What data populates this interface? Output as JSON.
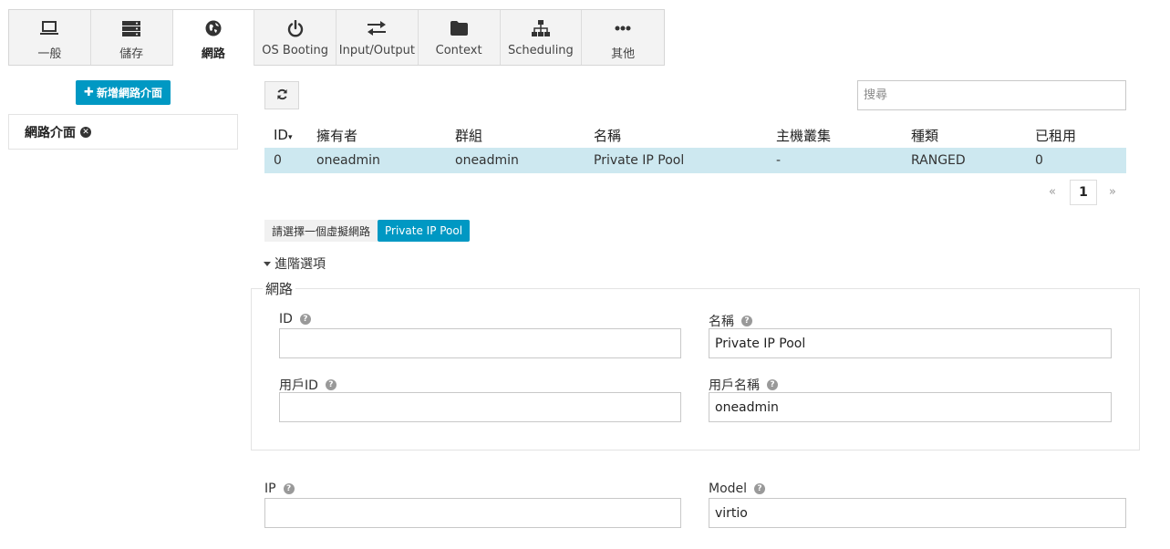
{
  "tabs": [
    {
      "label": "一般",
      "icon": "laptop-icon"
    },
    {
      "label": "儲存",
      "icon": "server-icon"
    },
    {
      "label": "網路",
      "icon": "globe-icon",
      "active": true
    },
    {
      "label": "OS Booting",
      "icon": "power-icon"
    },
    {
      "label": "Input/Output",
      "icon": "exchange-icon"
    },
    {
      "label": "Context",
      "icon": "folder-icon"
    },
    {
      "label": "Scheduling",
      "icon": "sitemap-icon"
    },
    {
      "label": "其他",
      "icon": "ellipsis-icon"
    }
  ],
  "left_panel": {
    "add_button": "新增網路介面",
    "nic_item": "網路介面"
  },
  "search": {
    "placeholder": "搜尋",
    "value": ""
  },
  "table": {
    "columns": [
      "ID",
      "擁有者",
      "群組",
      "名稱",
      "主機叢集",
      "種類",
      "已租用"
    ],
    "sort_indicator": "▾",
    "rows": [
      [
        "0",
        "oneadmin",
        "oneadmin",
        "Private IP Pool",
        "-",
        "RANGED",
        "0"
      ]
    ]
  },
  "pagination": {
    "prev": "«",
    "current": "1",
    "next": "»"
  },
  "selection": {
    "label": "請選擇一個虛擬網路",
    "selected": "Private IP Pool"
  },
  "advanced": {
    "label": "進階選項"
  },
  "network_fieldset": {
    "legend": "網路",
    "id_label": "ID",
    "id_value": "",
    "name_label": "名稱",
    "name_value": "Private IP Pool",
    "uid_label": "用戶ID",
    "uid_value": "",
    "uname_label": "用戶名稱",
    "uname_value": "oneadmin"
  },
  "ip_field": {
    "label": "IP",
    "value": ""
  },
  "model_field": {
    "label": "Model",
    "value": "virtio"
  },
  "colors": {
    "accent": "#0098c3",
    "selected_row": "#cde8f0"
  }
}
